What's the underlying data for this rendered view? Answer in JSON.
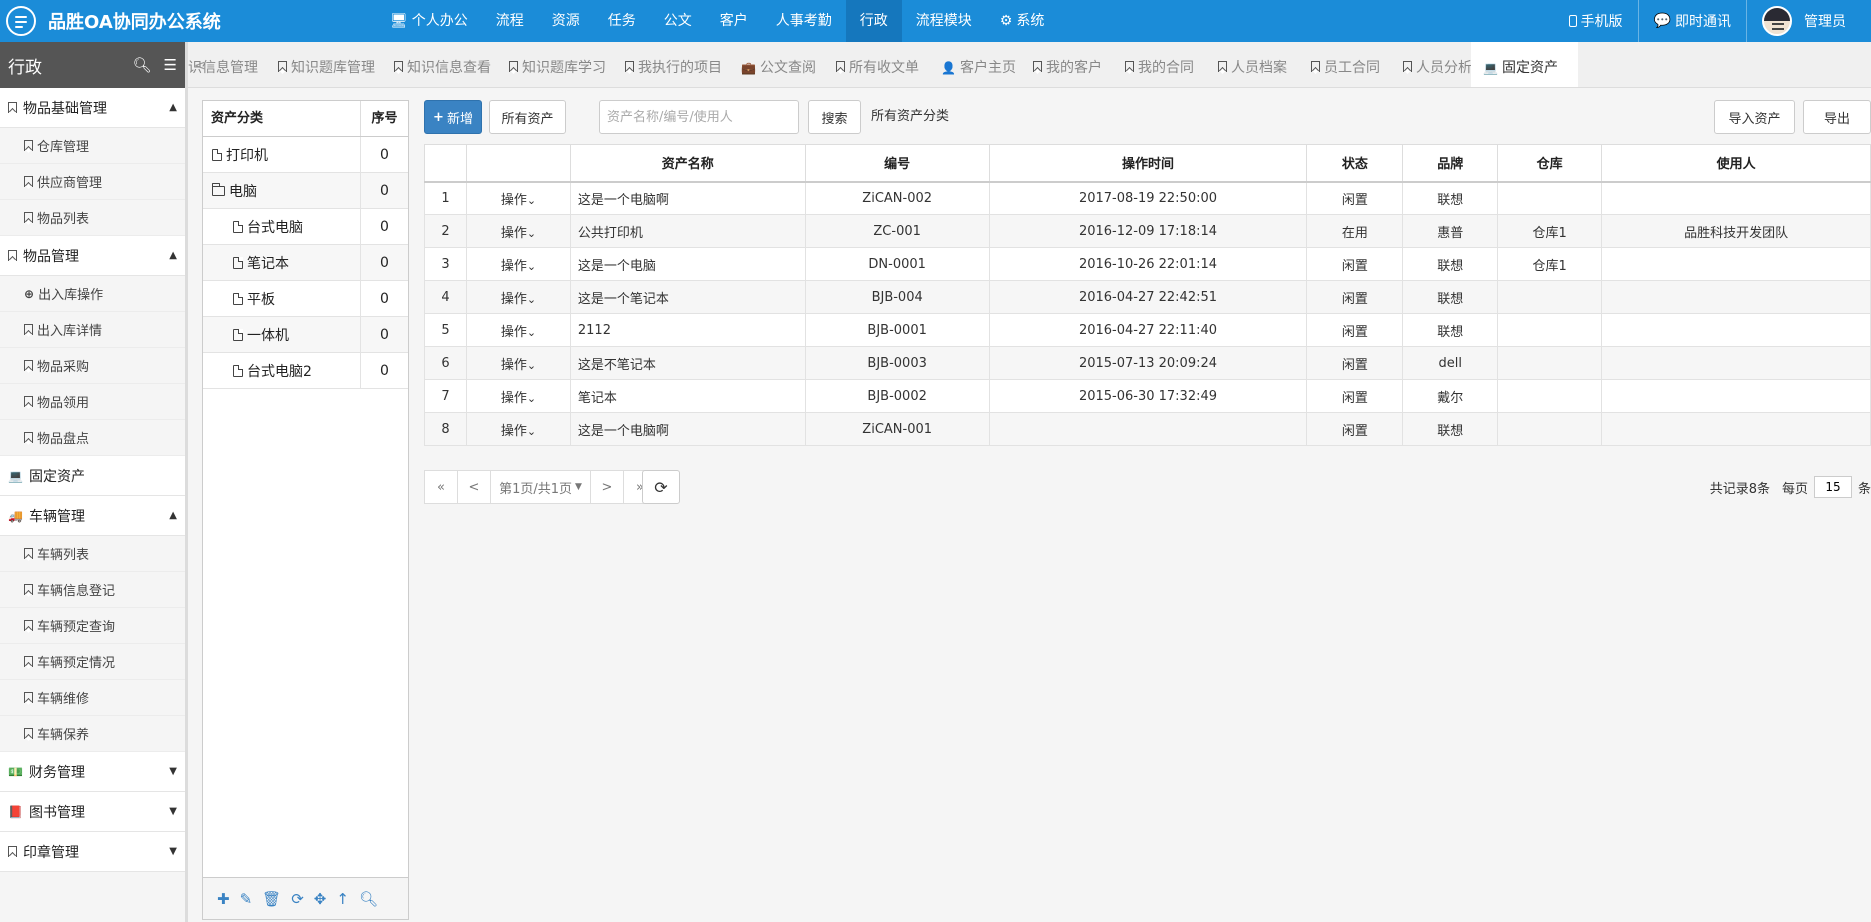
{
  "app": {
    "title": "品胜OA协同办公系统"
  },
  "topnav": [
    {
      "label": "个人办公",
      "icon": "monitor-icon",
      "glyph": "🖥"
    },
    {
      "label": "流程",
      "icon": "",
      "glyph": ""
    },
    {
      "label": "资源",
      "icon": "",
      "glyph": ""
    },
    {
      "label": "任务",
      "icon": "",
      "glyph": ""
    },
    {
      "label": "公文",
      "icon": "",
      "glyph": ""
    },
    {
      "label": "客户",
      "icon": "",
      "glyph": ""
    },
    {
      "label": "人事考勤",
      "icon": "",
      "glyph": ""
    },
    {
      "label": "行政",
      "icon": "",
      "glyph": "",
      "active": true
    },
    {
      "label": "流程模块",
      "icon": "",
      "glyph": ""
    },
    {
      "label": "系统",
      "icon": "gear-icon",
      "glyph": "⚙"
    }
  ],
  "topright": {
    "mobile": "手机版",
    "im": "即时通讯",
    "user": "管理员"
  },
  "sidebar": {
    "title": "行政",
    "groups": [
      {
        "label": "物品基础管理",
        "icon": "bookmark-icon",
        "expanded": true,
        "items": [
          "仓库管理",
          "供应商管理",
          "物品列表"
        ]
      },
      {
        "label": "物品管理",
        "icon": "bookmark-icon",
        "expanded": true,
        "items": [
          "出入库操作",
          "出入库详情",
          "物品采购",
          "物品领用",
          "物品盘点"
        ]
      },
      {
        "label": "固定资产",
        "icon": "laptop-icon",
        "expanded": false,
        "leaf": true,
        "items": []
      },
      {
        "label": "车辆管理",
        "icon": "truck-icon",
        "expanded": true,
        "items": [
          "车辆列表",
          "车辆信息登记",
          "车辆预定查询",
          "车辆预定情况",
          "车辆维修",
          "车辆保养"
        ]
      },
      {
        "label": "财务管理",
        "icon": "money-icon",
        "expanded": false,
        "items": []
      },
      {
        "label": "图书管理",
        "icon": "book-icon",
        "expanded": false,
        "items": []
      },
      {
        "label": "印章管理",
        "icon": "bookmark-icon",
        "expanded": false,
        "items": []
      }
    ]
  },
  "tabs": [
    {
      "label": "知识信息管理",
      "icon": ""
    },
    {
      "label": "知识题库管理",
      "icon": "bookmark-icon"
    },
    {
      "label": "知识信息查看",
      "icon": "bookmark-icon"
    },
    {
      "label": "知识题库学习",
      "icon": "bookmark-icon"
    },
    {
      "label": "我执行的项目",
      "icon": "bookmark-icon"
    },
    {
      "label": "公文查阅",
      "icon": "briefcase-icon"
    },
    {
      "label": "所有收文单",
      "icon": "bookmark-icon"
    },
    {
      "label": "客户主页",
      "icon": "user-icon"
    },
    {
      "label": "我的客户",
      "icon": "bookmark-icon"
    },
    {
      "label": "我的合同",
      "icon": "bookmark-icon"
    },
    {
      "label": "人员档案",
      "icon": "bookmark-icon"
    },
    {
      "label": "员工合同",
      "icon": "bookmark-icon"
    },
    {
      "label": "人员分析",
      "icon": "bookmark-icon"
    },
    {
      "label": "固定资产",
      "icon": "laptop-icon",
      "active": true
    }
  ],
  "tree": {
    "header": {
      "name": "资产分类",
      "order": "序号"
    },
    "rows": [
      {
        "label": "打印机",
        "order": "0",
        "type": "file",
        "level": 0
      },
      {
        "label": "电脑",
        "order": "0",
        "type": "folder",
        "level": 0
      },
      {
        "label": "台式电脑",
        "order": "0",
        "type": "file",
        "level": 1
      },
      {
        "label": "笔记本",
        "order": "0",
        "type": "file",
        "level": 1
      },
      {
        "label": "平板",
        "order": "0",
        "type": "file",
        "level": 1
      },
      {
        "label": "一体机",
        "order": "0",
        "type": "file",
        "level": 1
      },
      {
        "label": "台式电脑2",
        "order": "0",
        "type": "file",
        "level": 1
      }
    ]
  },
  "toolbar": {
    "add": "新增",
    "all_assets": "所有资产",
    "search_placeholder": "资产名称/编号/使用人",
    "search": "搜索",
    "category_label": "所有资产分类",
    "import": "导入资产",
    "export": "导出"
  },
  "table": {
    "columns": [
      "",
      "",
      "资产名称",
      "编号",
      "操作时间",
      "状态",
      "品牌",
      "仓库",
      "使用人"
    ],
    "op_label": "操作",
    "rows": [
      {
        "no": "1",
        "name": "这是一个电脑啊",
        "code": "ZiCAN-002",
        "time": "2017-08-19 22:50:00",
        "status": "闲置",
        "status_type": "idle",
        "brand": "联想",
        "warehouse": "",
        "user": ""
      },
      {
        "no": "2",
        "name": "公共打印机",
        "code": "ZC-001",
        "time": "2016-12-09 17:18:14",
        "status": "在用",
        "status_type": "use",
        "brand": "惠普",
        "warehouse": "仓库1",
        "user": "品胜科技开发团队"
      },
      {
        "no": "3",
        "name": "这是一个电脑",
        "code": "DN-0001",
        "time": "2016-10-26 22:01:14",
        "status": "闲置",
        "status_type": "idle",
        "brand": "联想",
        "warehouse": "仓库1",
        "user": ""
      },
      {
        "no": "4",
        "name": "这是一个笔记本",
        "code": "BJB-004",
        "time": "2016-04-27 22:42:51",
        "status": "闲置",
        "status_type": "idle",
        "brand": "联想",
        "warehouse": "",
        "user": ""
      },
      {
        "no": "5",
        "name": "2112",
        "code": "BJB-0001",
        "time": "2016-04-27 22:11:40",
        "status": "闲置",
        "status_type": "idle",
        "brand": "联想",
        "warehouse": "",
        "user": ""
      },
      {
        "no": "6",
        "name": "这是不笔记本",
        "code": "BJB-0003",
        "time": "2015-07-13 20:09:24",
        "status": "闲置",
        "status_type": "idle",
        "brand": "dell",
        "warehouse": "",
        "user": ""
      },
      {
        "no": "7",
        "name": "笔记本",
        "code": "BJB-0002",
        "time": "2015-06-30 17:32:49",
        "status": "闲置",
        "status_type": "idle",
        "brand": "戴尔",
        "warehouse": "",
        "user": ""
      },
      {
        "no": "8",
        "name": "这是一个电脑啊",
        "code": "ZiCAN-001",
        "time": "",
        "status": "闲置",
        "status_type": "idle",
        "brand": "联想",
        "warehouse": "",
        "user": ""
      }
    ]
  },
  "pager": {
    "first": "«",
    "prev": "<",
    "page_label": "第1页/共1页",
    "next": ">",
    "last": "»",
    "total": "共记录8条",
    "per_page_label": "每页",
    "per_page": "15",
    "unit": "条"
  },
  "colors": {
    "topbar": "#1b8cd8",
    "topnav_active": "#1577bd",
    "primary": "#3a83c3",
    "status_idle": "#2040a8",
    "status_use": "#e67e22",
    "sidebar_head": "#555555"
  }
}
